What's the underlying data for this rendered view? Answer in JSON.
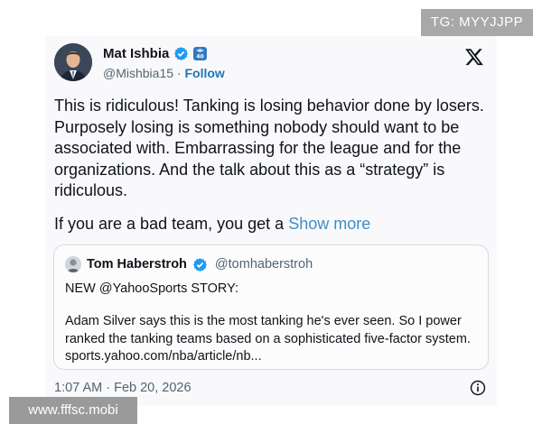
{
  "watermarks": {
    "top": "TG: MYYJJPP",
    "bottom": "www.fffsc.mobi"
  },
  "tweet": {
    "author": {
      "display_name": "Mat Ishbia",
      "handle": "@Mishbia15",
      "separator": "·",
      "follow_label": "Follow",
      "org_badge_text": "40"
    },
    "text": "This is ridiculous! Tanking is losing behavior done by losers. Purposely losing is something nobody should want to be associated with. Embarrassing for the league and for the organizations. And the talk about this as a “strategy” is ridiculous.",
    "text_continued": "If you are a bad team, you get a",
    "show_more_label": "Show more",
    "timestamp": "1:07 AM · Feb 20, 2026"
  },
  "quoted": {
    "display_name": "Tom Haberstroh",
    "handle": "@tomhaberstroh",
    "line1": "NEW @YahooSports STORY:",
    "body": "Adam Silver says this is the most tanking he's ever seen. So I power ranked the tanking teams based on a sophisticated five-factor system. sports.yahoo.com/nba/article/nb..."
  },
  "colors": {
    "link": "#1d76b8",
    "verified": "#1d9bf0",
    "show_more": "#3d8ec9"
  },
  "icons": [
    "verified-badge-icon",
    "org-badge-icon",
    "x-logo-icon",
    "info-icon"
  ]
}
